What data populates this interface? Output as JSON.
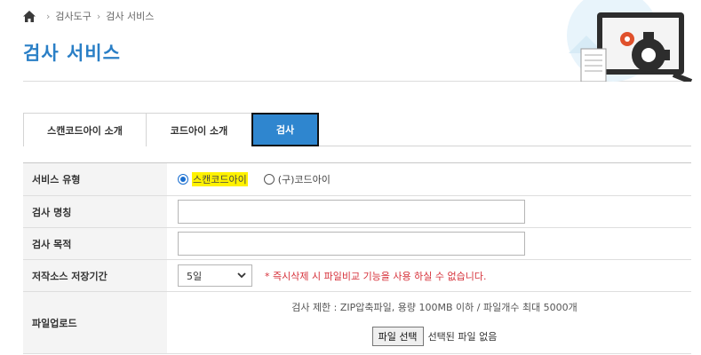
{
  "breadcrumb": {
    "items": [
      "검사도구",
      "검사 서비스"
    ]
  },
  "page": {
    "title": "검사 서비스"
  },
  "tabs": [
    {
      "label": "스캔코드아이 소개"
    },
    {
      "label": "코드아이 소개"
    },
    {
      "label": "검사",
      "active": true
    }
  ],
  "form": {
    "service_type": {
      "label": "서비스 유형",
      "options": [
        {
          "label": "스캔코드아이",
          "selected": true,
          "highlight": "#fff200"
        },
        {
          "label": "(구)코드아이",
          "selected": false
        }
      ]
    },
    "name": {
      "label": "검사 명칭",
      "value": ""
    },
    "purpose": {
      "label": "검사 목적",
      "value": ""
    },
    "retention": {
      "label": "저작소스 저장기간",
      "selected": "5일",
      "warning": "* 즉시삭제 시 파일비교 기능을 사용 하실 수 없습니다."
    },
    "upload": {
      "label": "파일업로드",
      "limit_text": "검사 제한 : ZIP압축파일, 용량 100MB 이하 / 파일개수 최대 5000개",
      "button_label": "파일 선택",
      "file_status": "선택된 파일 없음"
    }
  },
  "colors": {
    "accent": "#2a7fc6",
    "active_tab": "#2f86cf",
    "warning": "#d6313a"
  },
  "icons": [
    "home-icon",
    "chevron-right-icon",
    "chevron-down-icon",
    "radio-icon",
    "monitor-gear-illustration"
  ]
}
